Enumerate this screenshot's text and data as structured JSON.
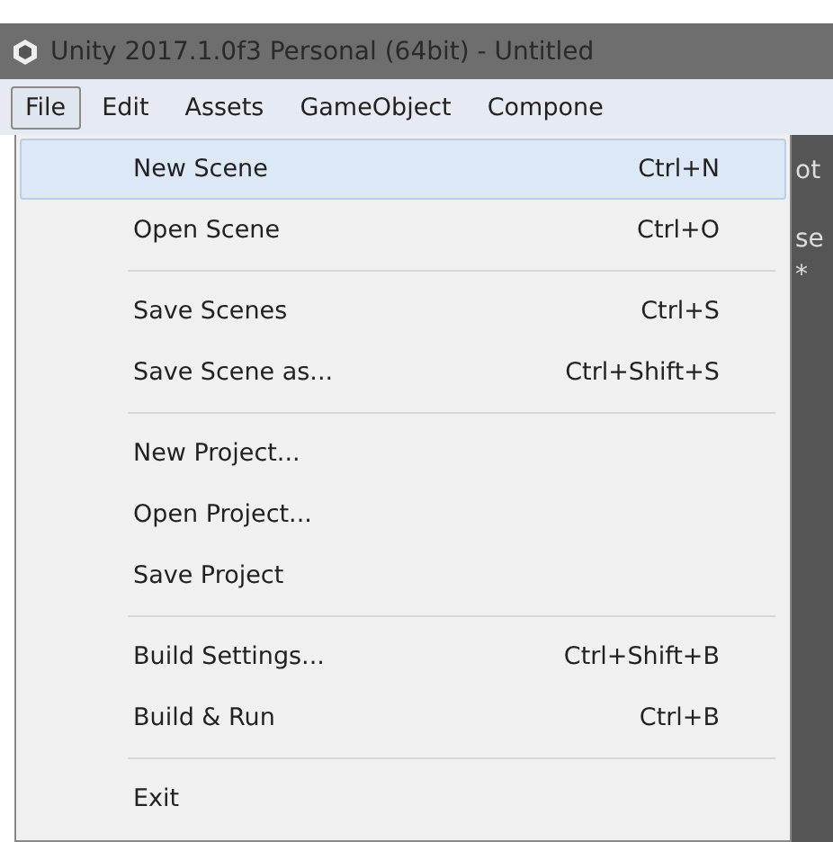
{
  "window": {
    "title": "Unity 2017.1.0f3 Personal (64bit) - Untitled"
  },
  "menubar": [
    {
      "label": "File",
      "selected": true
    },
    {
      "label": "Edit",
      "selected": false
    },
    {
      "label": "Assets",
      "selected": false
    },
    {
      "label": "GameObject",
      "selected": false
    },
    {
      "label": "Compone",
      "selected": false
    }
  ],
  "background_panel": {
    "texts": [
      "ot",
      "se",
      "*"
    ]
  },
  "file_menu": [
    {
      "kind": "item",
      "label": "New Scene",
      "shortcut": "Ctrl+N",
      "selected": true
    },
    {
      "kind": "item",
      "label": "Open Scene",
      "shortcut": "Ctrl+O",
      "selected": false
    },
    {
      "kind": "separator"
    },
    {
      "kind": "item",
      "label": "Save Scenes",
      "shortcut": "Ctrl+S",
      "selected": false
    },
    {
      "kind": "item",
      "label": "Save Scene as...",
      "shortcut": "Ctrl+Shift+S",
      "selected": false
    },
    {
      "kind": "separator"
    },
    {
      "kind": "item",
      "label": "New Project...",
      "selected": false
    },
    {
      "kind": "item",
      "label": "Open Project...",
      "selected": false
    },
    {
      "kind": "item",
      "label": "Save Project",
      "selected": false
    },
    {
      "kind": "separator"
    },
    {
      "kind": "item",
      "label": "Build Settings...",
      "shortcut": "Ctrl+Shift+B",
      "selected": false
    },
    {
      "kind": "item",
      "label": "Build & Run",
      "shortcut": "Ctrl+B",
      "selected": false
    },
    {
      "kind": "separator"
    },
    {
      "kind": "item",
      "label": "Exit",
      "selected": false
    }
  ]
}
